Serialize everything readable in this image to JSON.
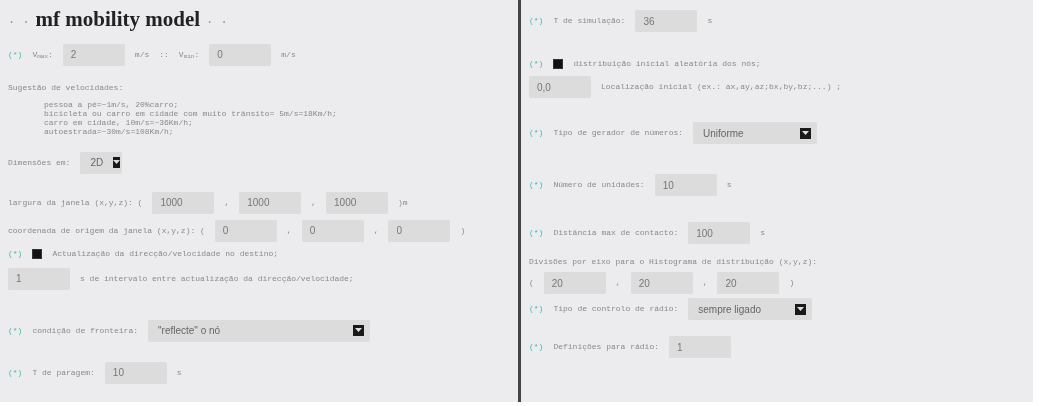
{
  "title": {
    "pre": ". .",
    "text": "mf mobility model",
    "post": ". ."
  },
  "left": [
    {
      "items": [
        {
          "kind": "required",
          "text": "(*)"
        },
        {
          "kind": "label",
          "text": "V$_{max}$:"
        },
        {
          "kind": "input",
          "value": "2"
        },
        {
          "kind": "label",
          "text": "m/s"
        },
        {
          "kind": "label",
          "text": "::"
        },
        {
          "kind": "label",
          "text": "V$_{min}$:"
        },
        {
          "kind": "input",
          "value": "0"
        },
        {
          "kind": "label",
          "text": "m/s"
        }
      ]
    },
    {
      "items": [
        {
          "kind": "label",
          "text": "Sugestão de velocidades:"
        }
      ]
    },
    {
      "items": [
        {
          "kind": "note",
          "lines": [
            "pessoa a pé=~1m/s, 20%carro;",
            "bicicleta ou carro em cidade com muito trânsito= 5m/s=18Km/h;",
            "carro em cidade, 10m/s=~36Km/h;",
            "autoestrada=~30m/s=108Km/h;"
          ]
        }
      ]
    },
    {
      "items": [
        {
          "kind": "label",
          "text": "Dimensões em:"
        },
        {
          "kind": "select",
          "value": "2D"
        }
      ]
    },
    {
      "items": [
        {
          "kind": "label",
          "text": "largura da janela (x,y,z): ("
        },
        {
          "kind": "input",
          "value": "1000"
        },
        {
          "kind": "label",
          "text": ","
        },
        {
          "kind": "input",
          "value": "1000"
        },
        {
          "kind": "label",
          "text": ","
        },
        {
          "kind": "input",
          "value": "1000"
        },
        {
          "kind": "label",
          "text": ")m"
        }
      ]
    },
    {
      "items": [
        {
          "kind": "label",
          "text": "coordenada de origem da janela (x,y,z): ("
        },
        {
          "kind": "input",
          "value": "0"
        },
        {
          "kind": "label",
          "text": ","
        },
        {
          "kind": "input",
          "value": "0"
        },
        {
          "kind": "label",
          "text": ","
        },
        {
          "kind": "input",
          "value": "0"
        },
        {
          "kind": "label",
          "text": ")"
        }
      ]
    },
    {
      "items": [
        {
          "kind": "required",
          "text": "(*)"
        },
        {
          "kind": "checkbox",
          "checked": true
        },
        {
          "kind": "label",
          "text": "Actualização da direcção/velocidade no destino;"
        }
      ]
    },
    {
      "items": [
        {
          "kind": "input",
          "value": "1"
        },
        {
          "kind": "label",
          "text": "s de intervalo entre actualização da direcção/velocidade;"
        }
      ]
    },
    {
      "items": [
        {
          "kind": "required",
          "text": "(*)"
        },
        {
          "kind": "label",
          "text": "condição de fronteira:"
        },
        {
          "kind": "select",
          "value": "\"reflecte\" o nó"
        }
      ]
    },
    {
      "items": [
        {
          "kind": "required",
          "text": "(*)"
        },
        {
          "kind": "label",
          "text": "T de paragem:"
        },
        {
          "kind": "input",
          "value": "10"
        },
        {
          "kind": "label",
          "text": "s"
        }
      ]
    }
  ],
  "right": [
    {
      "items": [
        {
          "kind": "required",
          "text": "(*)"
        },
        {
          "kind": "label",
          "text": "T de simulação:"
        },
        {
          "kind": "input",
          "value": "36"
        },
        {
          "kind": "label",
          "text": "s"
        }
      ]
    },
    {
      "items": [
        {
          "kind": "required",
          "text": "(*)"
        },
        {
          "kind": "checkbox",
          "checked": true
        },
        {
          "kind": "label",
          "text": "distribuição inicial aleatória dos nós;"
        }
      ]
    },
    {
      "items": [
        {
          "kind": "input",
          "value": "0,0"
        },
        {
          "kind": "label",
          "text": "Localização inicial (ex.: ax,ay,az;bx,by,bz;...) ;"
        }
      ]
    },
    {
      "items": [
        {
          "kind": "required",
          "text": "(*)"
        },
        {
          "kind": "label",
          "text": "Tipo de gerador de números:"
        },
        {
          "kind": "select",
          "value": "Uniforme"
        }
      ]
    },
    {
      "items": [
        {
          "kind": "required",
          "text": "(*)"
        },
        {
          "kind": "label",
          "text": "Número de unidades:"
        },
        {
          "kind": "input",
          "value": "10"
        },
        {
          "kind": "label",
          "text": "s"
        }
      ]
    },
    {
      "items": [
        {
          "kind": "required",
          "text": "(*)"
        },
        {
          "kind": "label",
          "text": "Distância max de contacto:"
        },
        {
          "kind": "input",
          "value": "100"
        },
        {
          "kind": "label",
          "text": "s"
        }
      ]
    },
    {
      "items": [
        {
          "kind": "label",
          "text": "Divisões por eixo para o Histograma de distribuição (x,y,z):"
        }
      ]
    },
    {
      "items": [
        {
          "kind": "label",
          "text": "("
        },
        {
          "kind": "input",
          "value": "20"
        },
        {
          "kind": "label",
          "text": ","
        },
        {
          "kind": "input",
          "value": "20"
        },
        {
          "kind": "label",
          "text": ","
        },
        {
          "kind": "input",
          "value": "20"
        },
        {
          "kind": "label",
          "text": ")"
        }
      ]
    },
    {
      "items": [
        {
          "kind": "required",
          "text": "(*)"
        },
        {
          "kind": "label",
          "text": "Tipo de controlo de rádio:"
        },
        {
          "kind": "select",
          "value": "sempre ligado"
        }
      ]
    },
    {
      "items": [
        {
          "kind": "required",
          "text": "(*)"
        },
        {
          "kind": "label",
          "text": "Definições para rádio:"
        },
        {
          "kind": "input",
          "value": "1"
        }
      ]
    }
  ]
}
